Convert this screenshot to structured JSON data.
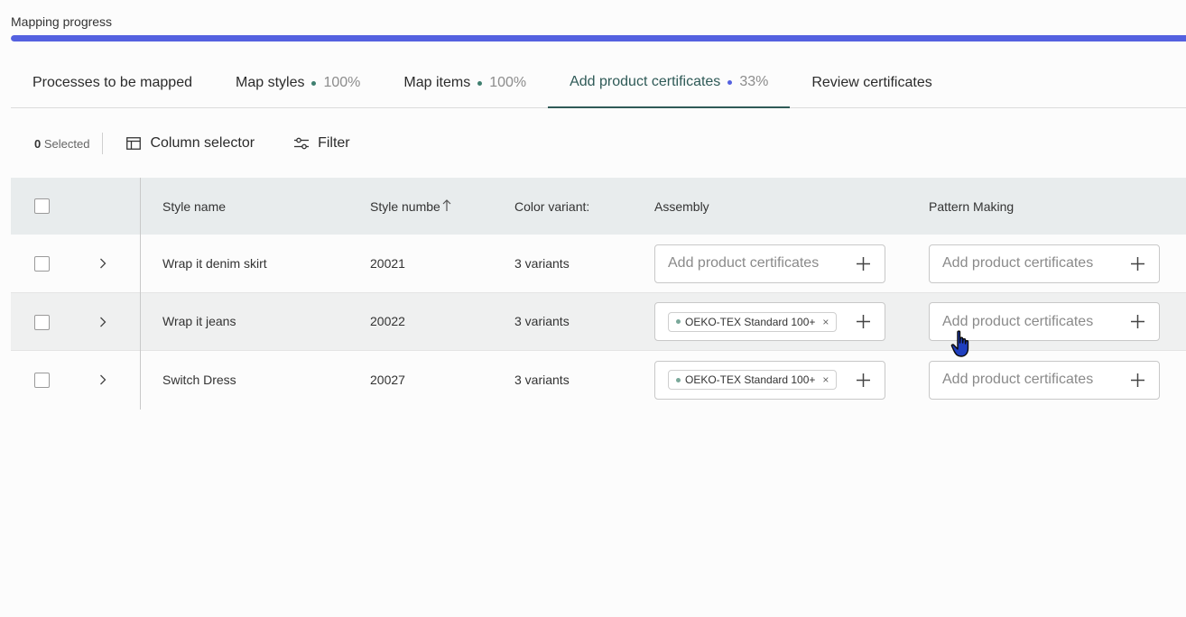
{
  "progress": {
    "label": "Mapping progress",
    "fraction": 1.0,
    "color": "#5461e0"
  },
  "tabs": [
    {
      "label": "Processes to be mapped",
      "dot": "",
      "pct": ""
    },
    {
      "label": "Map styles",
      "dot": "#3f7f6f",
      "pct": "100%"
    },
    {
      "label": "Map items",
      "dot": "#3f7f6f",
      "pct": "100%"
    },
    {
      "label": "Add product certificates",
      "dot": "#5461e0",
      "pct": "33%",
      "active": true
    },
    {
      "label": "Review certificates",
      "dot": "",
      "pct": ""
    }
  ],
  "toolbar": {
    "selected_count": "0",
    "selected_label": "Selected",
    "column_selector": "Column selector",
    "filter": "Filter"
  },
  "columns": {
    "style_name": "Style name",
    "style_number": "Style numbе",
    "color_variants": "Color variant:",
    "assembly": "Assembly",
    "pattern_making": "Pattern Making"
  },
  "placeholder": "Add product certificates",
  "rows": [
    {
      "name": "Wrap it denim skirt",
      "number": "20021",
      "variants": "3 variants",
      "assembly_tag": "",
      "pattern_tag": ""
    },
    {
      "name": "Wrap it jeans",
      "number": "20022",
      "variants": "3 variants",
      "assembly_tag": "OEKO-TEX Standard 100+",
      "pattern_tag": ""
    },
    {
      "name": "Switch Dress",
      "number": "20027",
      "variants": "3 variants",
      "assembly_tag": "OEKO-TEX Standard 100+",
      "pattern_tag": ""
    }
  ],
  "colors": {
    "accent": "#2f5a57",
    "tag_dot": "#7aa89a",
    "header_bg": "#e8eced"
  }
}
